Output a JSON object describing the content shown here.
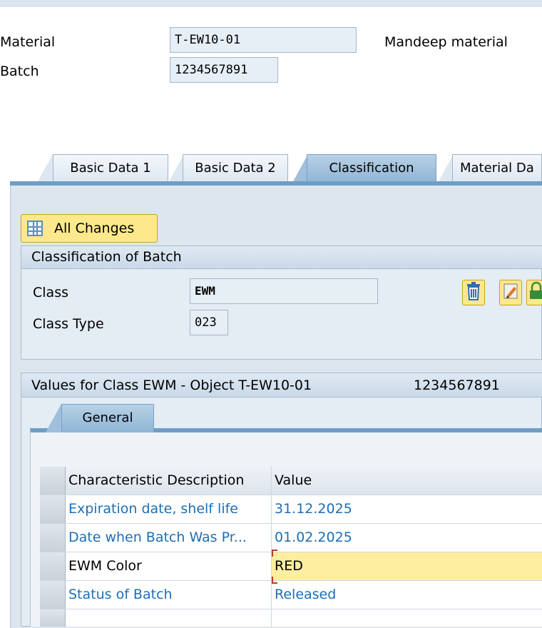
{
  "header": {
    "material_label": "Material",
    "material_value": "T-EW10-01",
    "material_desc": "Mandeep material",
    "batch_label": "Batch",
    "batch_value": "1234567891"
  },
  "tabs": [
    {
      "label": "Basic Data 1",
      "active": false
    },
    {
      "label": "Basic Data 2",
      "active": false
    },
    {
      "label": "Classification",
      "active": true
    },
    {
      "label": "Material Da",
      "active": false
    }
  ],
  "toolbar": {
    "all_changes_label": "All Changes",
    "all_changes_icon": "table-icon"
  },
  "classification": {
    "title": "Classification of Batch",
    "class_label": "Class",
    "class_value": "EWM",
    "class_type_label": "Class Type",
    "class_type_value": "023",
    "icons": [
      "trash-icon",
      "edit-icon",
      "lock-icon"
    ]
  },
  "values_section": {
    "title": "Values for Class EWM - Object T-EW10-01",
    "batch": "1234567891",
    "subtab": "General",
    "columns": [
      "Characteristic Description",
      "Value"
    ],
    "rows": [
      {
        "description": "Expiration date, shelf life",
        "value": "31.12.2025"
      },
      {
        "description": "Date when Batch Was Pr...",
        "value": "01.02.2025"
      },
      {
        "description": "EWM Color",
        "value": "RED"
      },
      {
        "description": "Status of Batch",
        "value": "Released"
      }
    ]
  },
  "colors": {
    "accent": "#fde88c",
    "link": "#1d6eb4",
    "tab_active": "#8fb5d6"
  }
}
